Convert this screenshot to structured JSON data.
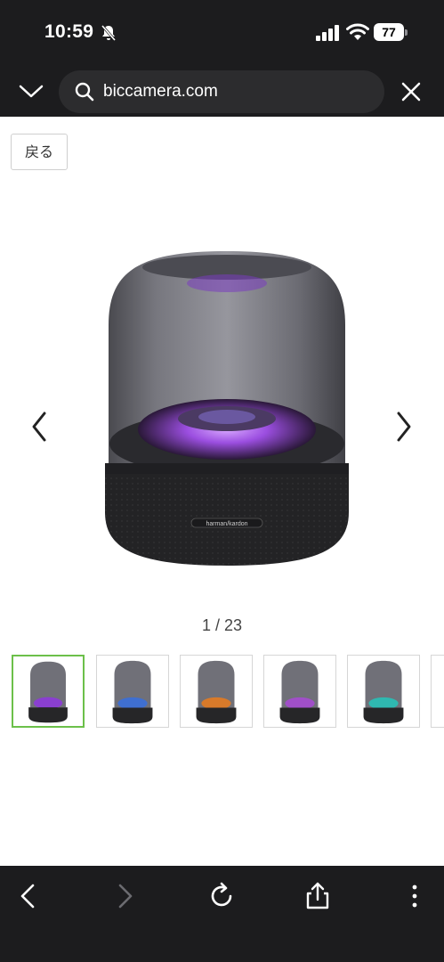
{
  "status_bar": {
    "time": "10:59",
    "battery": "77"
  },
  "address_bar": {
    "url": "biccamera.com"
  },
  "page": {
    "back_label": "戻る",
    "image_counter": "1 / 23",
    "product_brand_on_image": "harman/kardon",
    "thumbnails": [
      {
        "accent": "#8a3fd0",
        "active": true
      },
      {
        "accent": "#3f6fd0",
        "active": false
      },
      {
        "accent": "#d87a2a",
        "active": false
      },
      {
        "accent": "#a04fc8",
        "active": false
      },
      {
        "accent": "#2fb8b0",
        "active": false
      }
    ]
  },
  "colors": {
    "chrome_bg": "#1c1c1e",
    "pill_bg": "#2c2c2e",
    "active_thumb_border": "#6cc04a",
    "speaker_glow": "#9b4ee0"
  },
  "icons": {
    "collapse": "chevron-down-icon",
    "search": "search-icon",
    "close": "close-icon",
    "silent": "bell-slash-icon",
    "prev_image": "chevron-left-icon",
    "next_image": "chevron-right-icon",
    "nav_back": "back-arrow-icon",
    "nav_forward": "forward-arrow-icon",
    "reload": "reload-icon",
    "share": "share-icon",
    "more": "more-vertical-icon"
  }
}
